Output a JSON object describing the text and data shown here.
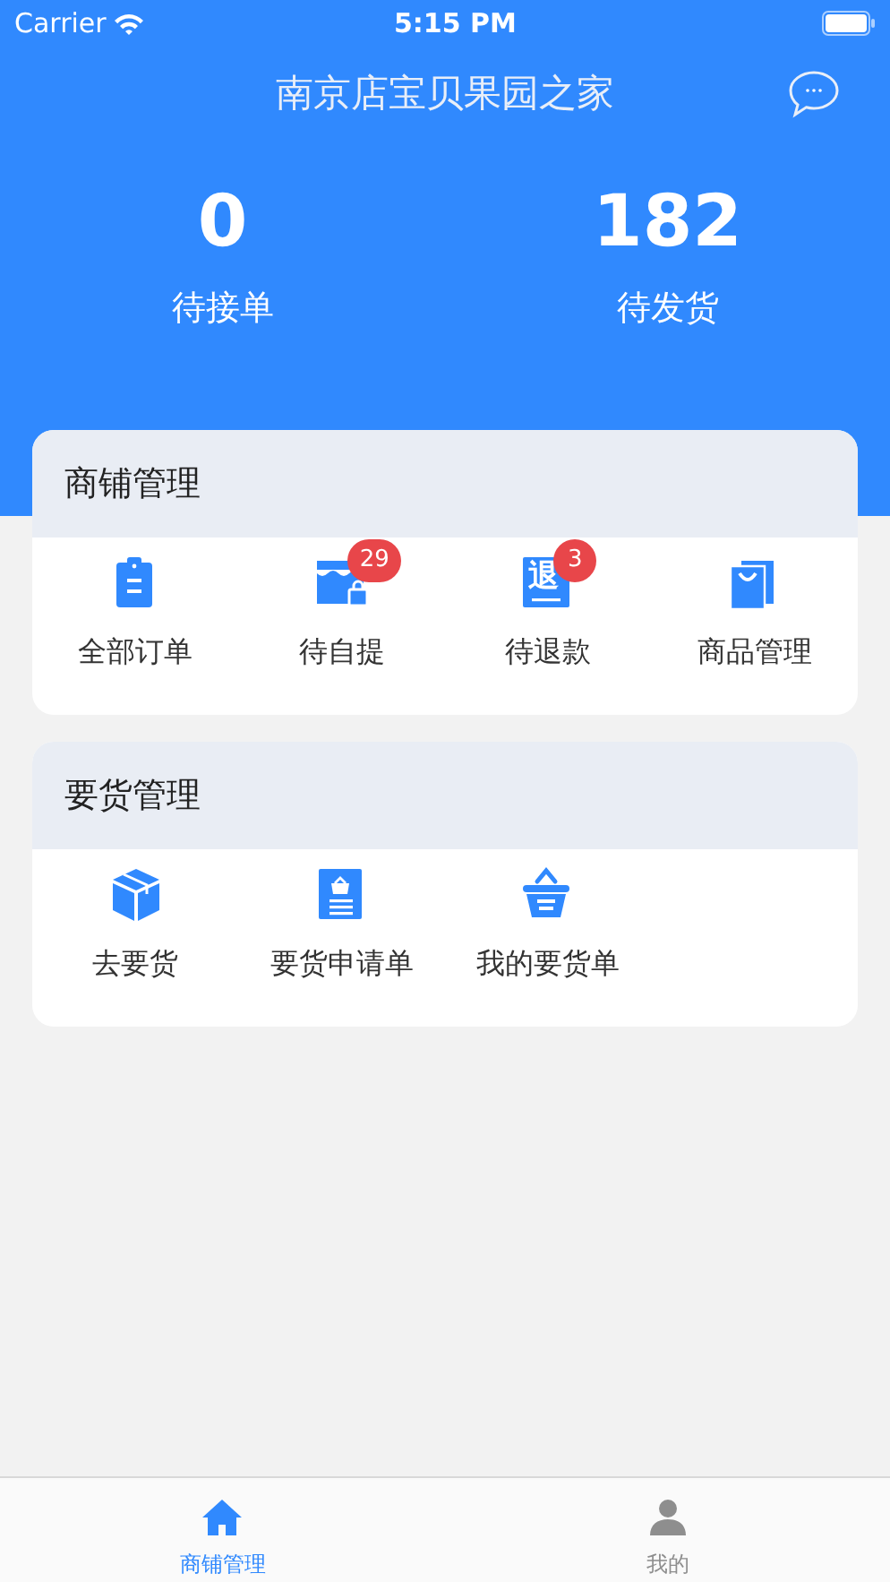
{
  "status_bar": {
    "carrier": "Carrier",
    "time": "5:15 PM"
  },
  "header": {
    "title": "南京店宝贝果园之家"
  },
  "stats": [
    {
      "value": "0",
      "label": "待接单"
    },
    {
      "value": "182",
      "label": "待发货"
    }
  ],
  "sections": [
    {
      "title": "商铺管理",
      "items": [
        {
          "kind": "clipboard",
          "label": "全部订单"
        },
        {
          "kind": "store",
          "label": "待自提",
          "badge": "29"
        },
        {
          "kind": "refund",
          "label": "待退款",
          "badge": "3",
          "icon_text": "退"
        },
        {
          "kind": "bag",
          "label": "商品管理"
        }
      ]
    },
    {
      "title": "要货管理",
      "items": [
        {
          "kind": "box",
          "label": "去要货"
        },
        {
          "kind": "form",
          "label": "要货申请单"
        },
        {
          "kind": "basket",
          "label": "我的要货单"
        }
      ]
    }
  ],
  "tab_bar": [
    {
      "kind": "home",
      "label": "商铺管理",
      "selected": true
    },
    {
      "kind": "person",
      "label": "我的",
      "selected": false
    }
  ]
}
